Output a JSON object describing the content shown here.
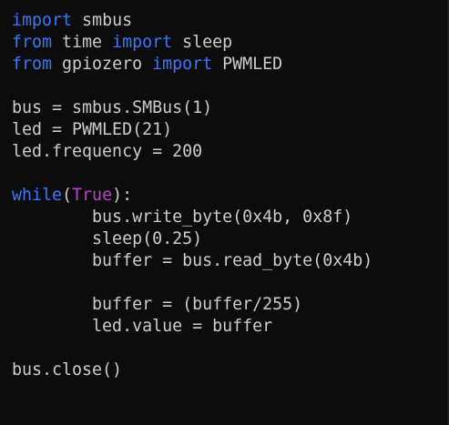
{
  "colors": {
    "background": "#0c0c0c",
    "text": "#cccccc",
    "keyword": "#3b78ff",
    "constant": "#b148c6"
  },
  "code": {
    "language": "python",
    "lines": [
      [
        {
          "t": "import",
          "k": "keyword"
        },
        {
          "t": " smbus",
          "k": "plain"
        }
      ],
      [
        {
          "t": "from",
          "k": "keyword"
        },
        {
          "t": " time ",
          "k": "plain"
        },
        {
          "t": "import",
          "k": "keyword"
        },
        {
          "t": " sleep",
          "k": "plain"
        }
      ],
      [
        {
          "t": "from",
          "k": "keyword"
        },
        {
          "t": " gpiozero ",
          "k": "plain"
        },
        {
          "t": "import",
          "k": "keyword"
        },
        {
          "t": " PWMLED",
          "k": "plain"
        }
      ],
      [],
      [
        {
          "t": "bus = smbus.SMBus(1)",
          "k": "plain"
        }
      ],
      [
        {
          "t": "led = PWMLED(21)",
          "k": "plain"
        }
      ],
      [
        {
          "t": "led.frequency = 200",
          "k": "plain"
        }
      ],
      [],
      [
        {
          "t": "while",
          "k": "keyword"
        },
        {
          "t": "(",
          "k": "plain"
        },
        {
          "t": "True",
          "k": "constant"
        },
        {
          "t": "):",
          "k": "plain"
        }
      ],
      [
        {
          "t": "        bus.write_byte(0x4b, 0x8f)",
          "k": "plain"
        }
      ],
      [
        {
          "t": "        sleep(0.25)",
          "k": "plain"
        }
      ],
      [
        {
          "t": "        buffer = bus.read_byte(0x4b)",
          "k": "plain"
        }
      ],
      [],
      [
        {
          "t": "        buffer = (buffer/255)",
          "k": "plain"
        }
      ],
      [
        {
          "t": "        led.value = buffer",
          "k": "plain"
        }
      ],
      [],
      [
        {
          "t": "bus.close()",
          "k": "plain"
        }
      ]
    ]
  }
}
